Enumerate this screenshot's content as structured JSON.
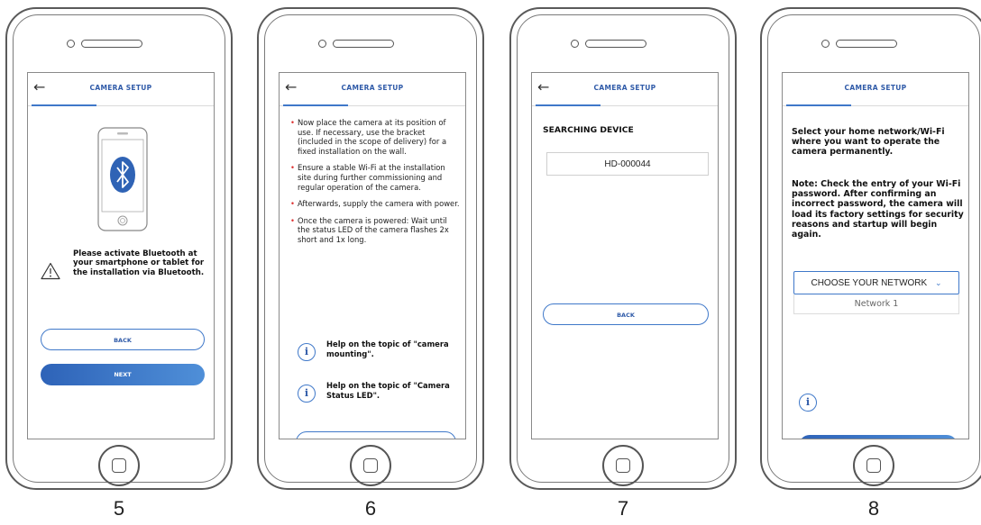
{
  "steps": [
    {
      "number": "5",
      "header_title": "CAMERA SETUP",
      "message": "Please activate Bluetooth at your smartphone or tablet for the installation via Bluetooth.",
      "back_label": "BACK",
      "next_label": "NEXT"
    },
    {
      "number": "6",
      "header_title": "CAMERA SETUP",
      "bullets": [
        "Now place the camera at its position of use. If necessary, use the bracket (included in the scope of delivery) for a fixed installation on the wall.",
        "Ensure a stable Wi-Fi at the installation site during further commissioning and regular operation of the camera.",
        "Afterwards, supply the camera with power.",
        "Once the camera is powered: Wait until the status LED of the camera flashes 2x short and 1x long."
      ],
      "help_mounting": "Help on the topic of \"camera mounting\".",
      "help_led": "Help on the topic of \"Camera Status LED\"."
    },
    {
      "number": "7",
      "header_title": "CAMERA SETUP",
      "heading": "SEARCHING DEVICE",
      "device_id": "HD-000044",
      "back_label": "BACK"
    },
    {
      "number": "8",
      "header_title": "CAMERA SETUP",
      "instruction": "Select your home network/Wi-Fi where you want to operate the camera permanently.",
      "note": "Note: Check the entry of your Wi-Fi password. After confirming an incorrect password, the camera will load its factory settings for security reasons and startup will begin again.",
      "select_label": "CHOOSE YOUR NETWORK",
      "option_1": "Network 1"
    }
  ]
}
